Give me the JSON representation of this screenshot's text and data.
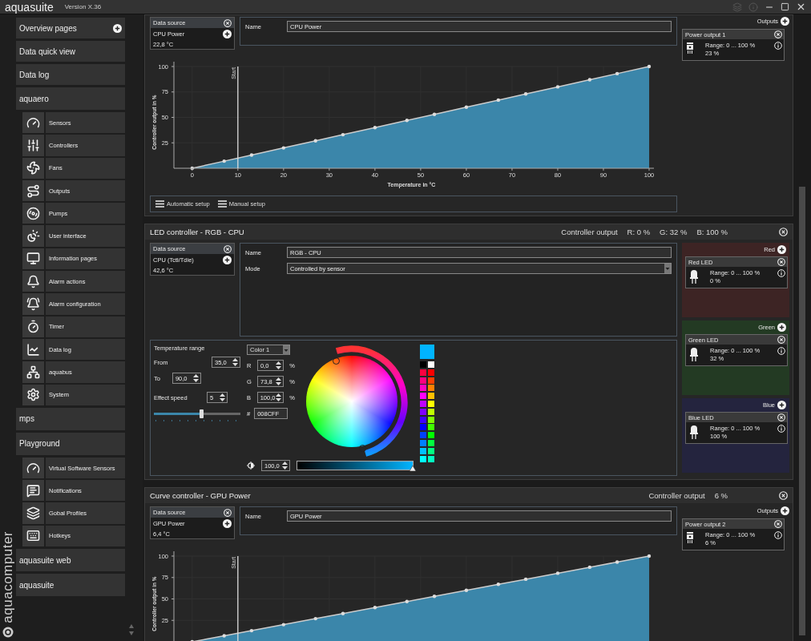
{
  "window": {
    "title": "aquasuite",
    "version": "Version X.36"
  },
  "sidebar": {
    "logo": "aquacomputer",
    "items": [
      {
        "label": "Overview pages",
        "add": true
      },
      {
        "label": "Data quick view",
        "add": false
      },
      {
        "label": "Data log",
        "add": false
      },
      {
        "label": "aquaero",
        "add": false,
        "children": [
          {
            "label": "Sensors"
          },
          {
            "label": "Controllers"
          },
          {
            "label": "Fans"
          },
          {
            "label": "Outputs"
          },
          {
            "label": "Pumps"
          },
          {
            "label": "User interface"
          },
          {
            "label": "Information pages"
          },
          {
            "label": "Alarm actions"
          },
          {
            "label": "Alarm configuration"
          },
          {
            "label": "Timer"
          },
          {
            "label": "Data log"
          },
          {
            "label": "aquabus"
          },
          {
            "label": "System"
          }
        ]
      },
      {
        "label": "mps",
        "add": false
      },
      {
        "label": "Playground",
        "add": false,
        "children": [
          {
            "label": "Virtual Software Sensors"
          },
          {
            "label": "Notifications"
          },
          {
            "label": "Gobal Profiles"
          },
          {
            "label": "Hotkeys"
          }
        ]
      },
      {
        "label": "aquasuite web",
        "add": false
      },
      {
        "label": "aquasuite",
        "add": false
      }
    ]
  },
  "panels": [
    {
      "kind": "curve",
      "data_source": {
        "title": "Data source",
        "name": "CPU Power",
        "value": "22,8 °C"
      },
      "fields": [
        {
          "kind": "text",
          "label": "Name",
          "value": "CPU Power"
        }
      ],
      "chart_data": {
        "type": "area",
        "grid": true,
        "xlabel": "Temperature in °C",
        "ylabel": "Controller output in %",
        "x": [
          0,
          7,
          13,
          20,
          27,
          33,
          40,
          47,
          53,
          60,
          67,
          73,
          80,
          87,
          93,
          100
        ],
        "series": [
          {
            "color": "#3b86aa",
            "values": [
              0,
              7,
              13,
              20,
              27,
              33,
              40,
              47,
              53,
              60,
              67,
              73,
              80,
              87,
              93,
              100
            ]
          }
        ],
        "xlim": [
          -4,
          100
        ],
        "ylim": [
          0,
          100
        ],
        "xticks": [
          0,
          10,
          20,
          30,
          40,
          50,
          60,
          70,
          80,
          90,
          100
        ],
        "yticks": [
          25,
          50,
          75,
          100
        ],
        "ref_lines": [
          {
            "axis": "x",
            "value": 10,
            "label": "Start"
          }
        ]
      },
      "setup_buttons": [
        "Automatic setup",
        "Manual setup"
      ],
      "outputs": {
        "title": "Outputs",
        "items": [
          {
            "name": "Power output 1",
            "range": "Range: 0 ... 100 %",
            "value": "23 %"
          }
        ]
      }
    },
    {
      "kind": "led",
      "header": {
        "title": "LED controller - RGB - CPU",
        "output_label": "Controller output",
        "readings": [
          "R: 0 %",
          "G: 32 %",
          "B: 100 %"
        ]
      },
      "data_source": {
        "title": "Data source",
        "name": "CPU (Tctl/Tdie)",
        "value": "42,6 °C"
      },
      "fields": [
        {
          "kind": "text",
          "label": "Name",
          "value": "RGB - CPU"
        },
        {
          "kind": "dropdown",
          "label": "Mode",
          "value": "Controlled by sensor"
        }
      ],
      "settings": {
        "range_title": "Temperature range",
        "from_label": "From",
        "from": "35,0",
        "to_label": "To",
        "to": "90,0",
        "effect_speed": {
          "label": "Effect speed",
          "value": "5",
          "level": 0.55
        },
        "color_select": "Color 1",
        "channels": [
          {
            "label": "R",
            "value": "0,0",
            "unit": "%"
          },
          {
            "label": "G",
            "value": "73,8",
            "unit": "%"
          },
          {
            "label": "B",
            "value": "100,0",
            "unit": "%"
          }
        ],
        "hex": {
          "label": "#",
          "value": "008CFF"
        },
        "brightness": {
          "value": "100,0",
          "level": 1
        },
        "current_swatch": {
          "color": "#00b4ff"
        },
        "swatches": [
          {
            "color": "#000000"
          },
          {
            "color": "#ffffff"
          },
          {
            "color": "#ff0040"
          },
          {
            "color": "#ff0000"
          },
          {
            "color": "#ff0080"
          },
          {
            "color": "#ff4000"
          },
          {
            "color": "#ff00c0"
          },
          {
            "color": "#ff8000"
          },
          {
            "color": "#ff00ff"
          },
          {
            "color": "#ffc000"
          },
          {
            "color": "#c000ff"
          },
          {
            "color": "#ffff00"
          },
          {
            "color": "#8000ff"
          },
          {
            "color": "#c0ff00"
          },
          {
            "color": "#4000ff"
          },
          {
            "color": "#80ff00"
          },
          {
            "color": "#0000ff"
          },
          {
            "color": "#40ff00"
          },
          {
            "color": "#0040ff"
          },
          {
            "color": "#00ff00"
          },
          {
            "color": "#0080ff"
          },
          {
            "color": "#00ff40"
          },
          {
            "color": "#00c0ff"
          },
          {
            "color": "#00ff80"
          },
          {
            "color": "#00ffff"
          },
          {
            "color": "#00ffc0"
          }
        ]
      },
      "output_groups": [
        {
          "title": "Red",
          "color": "#3d2424",
          "items": [
            {
              "name": "Red LED",
              "range": "Range: 0 ... 100 %",
              "value": "0 %"
            }
          ]
        },
        {
          "title": "Green",
          "color": "#233a23",
          "items": [
            {
              "name": "Green LED",
              "range": "Range: 0 ... 100 %",
              "value": "32 %"
            }
          ]
        },
        {
          "title": "Blue",
          "color": "#24243e",
          "items": [
            {
              "name": "Blue LED",
              "range": "Range: 0 ... 100 %",
              "value": "100 %"
            }
          ]
        }
      ]
    },
    {
      "kind": "curve",
      "header": {
        "title": "Curve controller - GPU Power",
        "output_label": "Controller output",
        "readings": [
          "6 %"
        ]
      },
      "data_source": {
        "title": "Data source",
        "name": "GPU Power",
        "value": "6,4 °C"
      },
      "fields": [
        {
          "kind": "text",
          "label": "Name",
          "value": "GPU Power"
        }
      ],
      "chart_data": {
        "type": "area",
        "grid": true,
        "ylabel": "Controller output in %",
        "x": [
          0,
          7,
          13,
          20,
          27,
          33,
          40,
          47,
          53,
          60,
          67,
          73,
          80,
          87,
          93,
          100
        ],
        "series": [
          {
            "color": "#3b86aa",
            "values": [
              0,
              7,
              13,
              20,
              27,
              33,
              40,
              47,
              53,
              60,
              67,
              73,
              80,
              87,
              93,
              100
            ]
          }
        ],
        "xlim": [
          -4,
          100
        ],
        "ylim": [
          0,
          100
        ],
        "yticks": [
          25,
          50,
          75,
          100
        ],
        "ref_lines": [
          {
            "axis": "x",
            "value": 10,
            "label": "Start"
          }
        ]
      },
      "outputs": {
        "title": "Outputs",
        "items": [
          {
            "name": "Power output 2",
            "range": "Range: 0 ... 100 %",
            "value": "6 %"
          }
        ]
      }
    }
  ]
}
